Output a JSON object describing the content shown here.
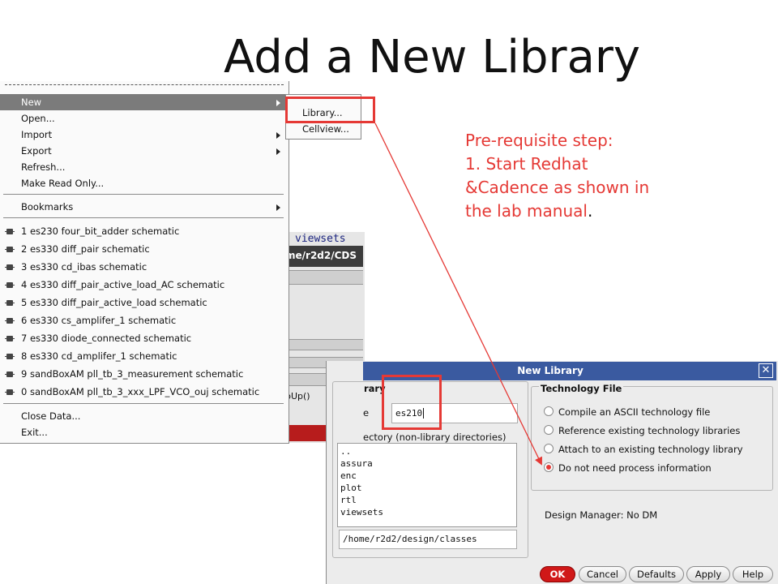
{
  "slide": {
    "title": "Add a New Library",
    "note": {
      "line1": "Pre-requisite step:",
      "line2": "1.  Start Redhat",
      "line3": "&Cadence as shown in",
      "line4": "the lab manual",
      "line4_dot": "."
    }
  },
  "background_window": {
    "viewsets": "viewsets",
    "path_fragment": "me/r2d2/CDS",
    "popup_fragment": "pUp()"
  },
  "file_menu": {
    "items": [
      {
        "label": "New",
        "submenu": true
      },
      {
        "label": "Open..."
      },
      {
        "label": "Import",
        "submenu": true
      },
      {
        "label": "Export",
        "submenu": true
      },
      {
        "label": "Refresh..."
      },
      {
        "label": "Make Read Only..."
      }
    ],
    "bookmarks_label": "Bookmarks",
    "recent": [
      {
        "label": "1 es230  four_bit_adder  schematic"
      },
      {
        "label": "2 es330  diff_pair  schematic"
      },
      {
        "label": "3 es330  cd_ibas  schematic"
      },
      {
        "label": "4 es330  diff_pair_active_load_AC  schematic"
      },
      {
        "label": "5 es330  diff_pair_active_load  schematic"
      },
      {
        "label": "6 es330  cs_amplifer_1  schematic"
      },
      {
        "label": "7 es330  diode_connected  schematic"
      },
      {
        "label": "8 es330  cd_amplifer_1  schematic"
      },
      {
        "label": "9 sandBoxAM  pll_tb_3_measurement  schematic"
      },
      {
        "label": "0 sandBoxAM  pll_tb_3_xxx_LPF_VCO_ouj  schematic"
      }
    ],
    "close_data_label": "Close Data...",
    "exit_label": "Exit..."
  },
  "new_submenu": {
    "library_label": "Library...",
    "cellview_label": "Cellview..."
  },
  "dialog": {
    "title": "New Library",
    "close_glyph": "✕",
    "library_group_title": "rary",
    "name_label": "e",
    "name_value": "es210",
    "directory_label": "ectory (non-library directories)",
    "directories": [
      "..",
      "assura",
      "enc",
      "plot",
      "rtl",
      "viewsets"
    ],
    "directory_path": "/home/r2d2/design/classes",
    "tech_group_title": "Technology File",
    "tech_options": [
      {
        "label": "Compile an ASCII technology file",
        "selected": false
      },
      {
        "label": "Reference existing technology libraries",
        "selected": false
      },
      {
        "label": "Attach to an existing technology library",
        "selected": false
      },
      {
        "label": "Do not need process information",
        "selected": true
      }
    ],
    "design_manager": "Design Manager: No DM",
    "buttons": {
      "ok": "OK",
      "cancel": "Cancel",
      "defaults": "Defaults",
      "apply": "Apply",
      "help": "Help"
    }
  },
  "colors": {
    "annotation_red": "#e53935",
    "dialog_titlebar": "#3a5aa0",
    "ok_button": "#d01818"
  }
}
